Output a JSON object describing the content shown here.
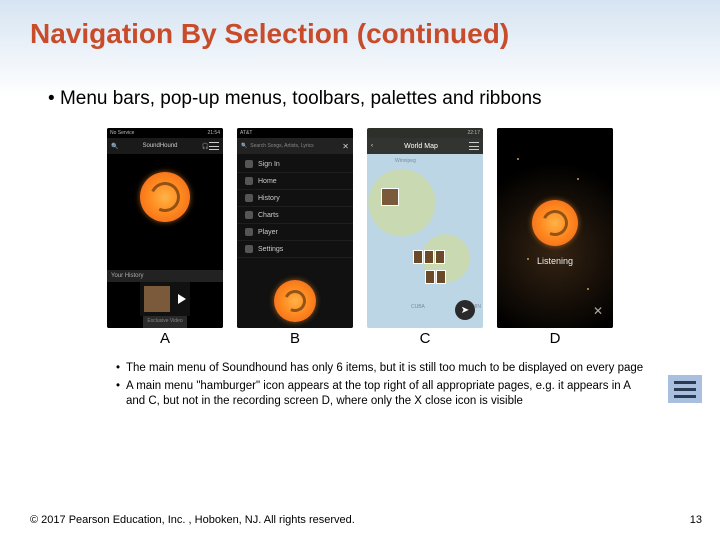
{
  "title": "Navigation By Selection (continued)",
  "main_bullet": "Menu bars, pop-up menus, toolbars, palettes and ribbons",
  "screens": {
    "A": {
      "label": "A",
      "status_left": "No Service",
      "status_right": "21:54",
      "top_center": "SoundHound",
      "history_label": "Your History",
      "footer_label": "Exclusive Video"
    },
    "B": {
      "label": "B",
      "status_left": "AT&T",
      "status_right": "",
      "search_placeholder": "Search Songs, Artists, Lyrics",
      "menu_items": [
        "Sign In",
        "Home",
        "History",
        "Charts",
        "Player",
        "Settings"
      ]
    },
    "C": {
      "label": "C",
      "status_left": "",
      "status_right": "22:17",
      "map_title": "World Map",
      "place1": "Winnipeg",
      "place2": "CUBA",
      "place3": "DOMIN"
    },
    "D": {
      "label": "D",
      "listening": "Listening"
    }
  },
  "sub_bullets": [
    "The main menu of Soundhound has only 6 items, but it is still too much to be displayed on every page",
    "A main menu \"hamburger\" icon appears at the top right of all appropriate pages, e.g. it appears in A and C, but not in the recording screen D, where only the X close icon is visible"
  ],
  "copyright": "© 2017 Pearson Education, Inc. , Hoboken, NJ.  All rights reserved.",
  "page_number": "13"
}
